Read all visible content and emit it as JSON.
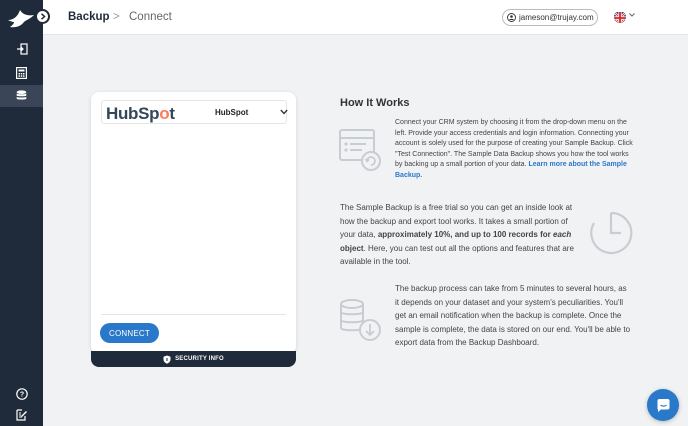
{
  "topbar": {
    "breadcrumb_main": "Backup",
    "breadcrumb_sep": ">",
    "breadcrumb_sub": "Connect",
    "user_email": "jameson@trujay.com"
  },
  "card": {
    "crm_logo_text_a": "HubSp",
    "crm_logo_text_b": "o",
    "crm_logo_text_c": "t",
    "crm_selected": "HubSpot",
    "connect_label": "CONNECT",
    "security_label": "SECURITY INFO"
  },
  "how_it_works": {
    "title": "How It Works",
    "block1_text": "Connect your CRM system by choosing it from the drop-down menu on the left. Provide your access credentials and login information. Connecting your account is solely used for the purpose of creating your Sample Backup. Click \"Test Connection\". The Sample Data Backup shows you how the tool works by backing up a small portion of your data.",
    "block1_link": "Learn more about the Sample Backup.",
    "block2_a": "The Sample Backup is a free trial so you can get an inside look at how the backup and export tool works. It takes a small portion of your data,",
    "block2_b": "approximately 10%, and up to 100 records for",
    "block2_c": "each",
    "block2_d": "object",
    "block2_e": ". Here, you can test out all the options and features that are available in the tool.",
    "block3_text": "The backup process can take from 5 minutes to several hours, as it depends on your dataset and your system's peculiarities. You'll get an email notification when the backup is complete. Once the sample is complete, the data is stored on our end. You'll be able to export data from the Backup Dashboard."
  },
  "icons": {
    "logo": "bird-logo-icon",
    "collapse": "chevron-right-icon",
    "sidebar": [
      "login-icon",
      "calculator-icon",
      "database-icon",
      "help-icon",
      "edit-report-icon"
    ],
    "chat": "chat-icon"
  },
  "colors": {
    "sidebar": "#1f2a3a",
    "accent": "#2a78c9",
    "hubspot_orange": "#ff7a59"
  }
}
